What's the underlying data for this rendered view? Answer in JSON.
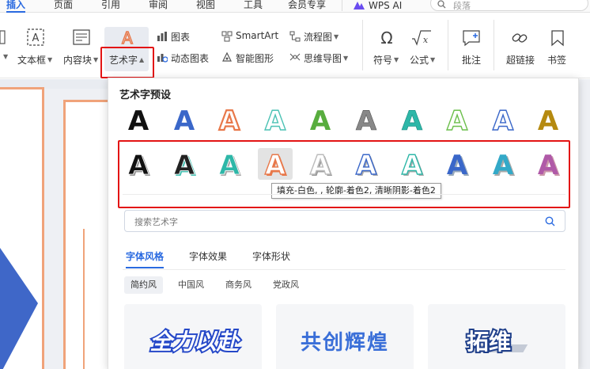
{
  "menubar": {
    "tabs": [
      "插入",
      "页面",
      "引用",
      "审阅",
      "视图",
      "工具",
      "会员专享"
    ],
    "active_tab": "插入",
    "wps_ai": "WPS AI",
    "search_placeholder": "段落"
  },
  "ribbon": {
    "textbox": "文本框",
    "content_block": "内容块",
    "wordart": "艺术字",
    "chart": "图表",
    "dynamic_chart": "动态图表",
    "smartart": "SmartArt",
    "smart_shape": "智能图形",
    "flowchart": "流程图",
    "mindmap": "思维导图",
    "symbol": "符号",
    "formula": "公式",
    "comment": "批注",
    "hyperlink": "超链接",
    "bookmark": "书签"
  },
  "wordart_panel": {
    "title": "艺术字预设",
    "glyph": "A",
    "tooltip": "填充-白色, , 轮廓-着色2, 清晰阴影-着色2",
    "search_placeholder": "搜索艺术字",
    "tabs": [
      "字体风格",
      "字体效果",
      "字体形状"
    ],
    "active_tab": "字体风格",
    "style_chips": [
      "简约风",
      "中国风",
      "商务风",
      "党政风"
    ],
    "active_chip": "简约风",
    "preview_cards": [
      "全力以赴",
      "共创辉煌",
      "拓维"
    ]
  },
  "colors": {
    "accent": "#2a6ae0",
    "highlight_red": "#e31414",
    "slide_orange": "#f0a37a",
    "slide_blue": "#3f67c8"
  }
}
